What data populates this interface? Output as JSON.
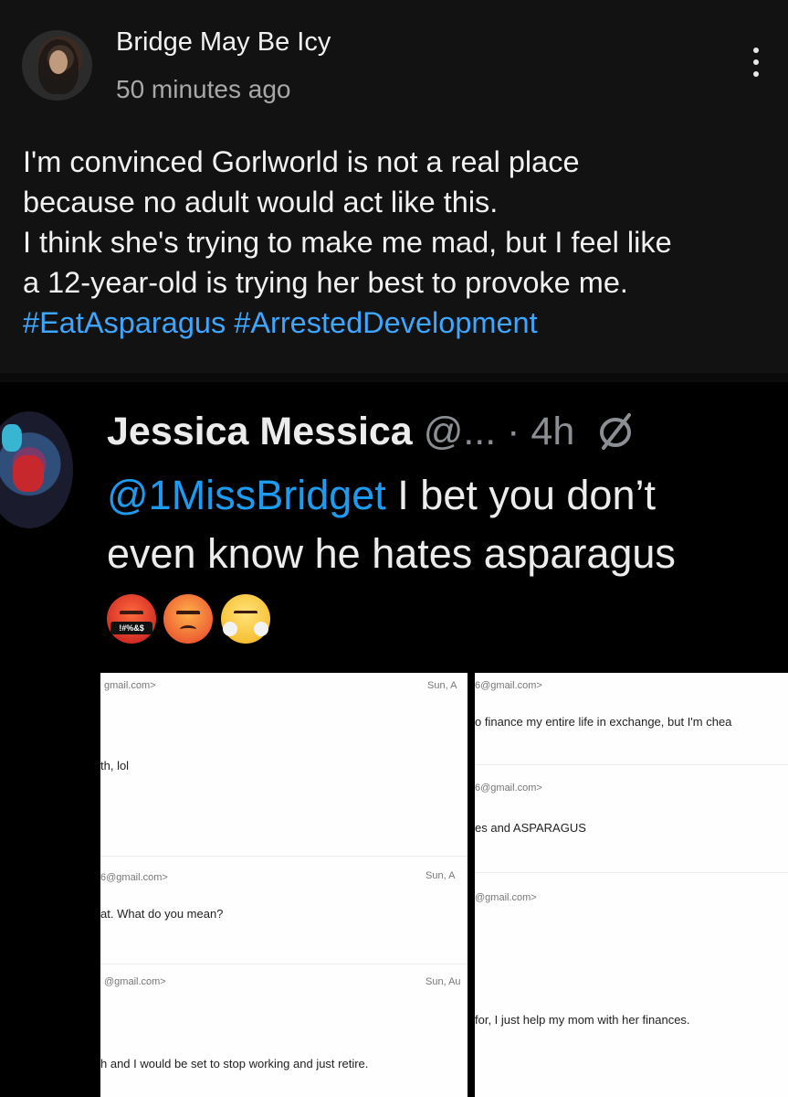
{
  "post": {
    "author": "Bridge May Be Icy",
    "timestamp": "50 minutes ago",
    "text_lines": [
      "I'm convinced Gorlworld is not a real place",
      "because no adult would act like this.",
      "I think she's trying to make me mad, but I feel like",
      "a 12-year-old is trying her best to provoke me."
    ],
    "hashtags": [
      "#EatAsparagus",
      "#ArrestedDevelopment"
    ],
    "menu_icon": "more-vert-icon"
  },
  "tweet": {
    "name": "Jessica Messica",
    "handle": "@...",
    "time": "· 4h",
    "mention": "@1MissBridget",
    "text_line1": " I bet you don’t",
    "text_line2": "even know he hates asparagus",
    "emoji_label": "!#%&$",
    "emojis": [
      "face-with-symbols-on-mouth",
      "angry-face",
      "face-with-steam-from-nose"
    ]
  },
  "emails": {
    "left": [
      {
        "addr": "gmail.com>",
        "date": "Sun, A"
      },
      {
        "msg": "th, lol"
      },
      {
        "addr": "6@gmail.com>",
        "date": "Sun, A"
      },
      {
        "msg": "at.  What do you mean?"
      },
      {
        "addr": "@gmail.com>",
        "date": "Sun, Au"
      },
      {
        "msg": "h and I would be set to stop working and just retire."
      }
    ],
    "right": [
      {
        "addr": "6@gmail.com>"
      },
      {
        "msg": "o finance my entire life in exchange, but I'm chea"
      },
      {
        "addr": "6@gmail.com>"
      },
      {
        "msg": "es and ASPARAGUS"
      },
      {
        "addr": "@gmail.com>"
      },
      {
        "msg": "for, I just help my mom with her finances."
      }
    ]
  }
}
